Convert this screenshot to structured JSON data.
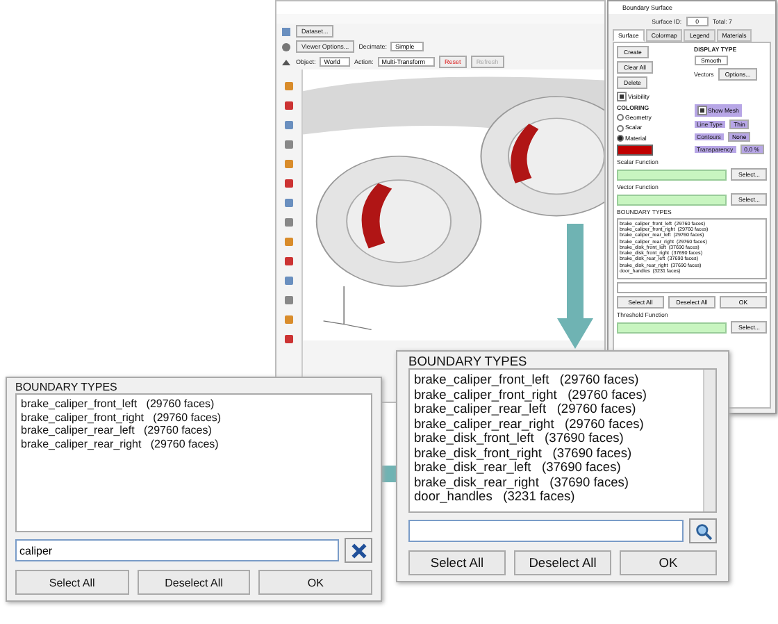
{
  "app_window": {
    "toolbar_rows": [
      [
        {
          "kind": "button",
          "label": "Dataset...",
          "danger": false,
          "disabled": false
        }
      ],
      [
        {
          "kind": "button",
          "label": "Viewer Options...",
          "danger": false,
          "disabled": false
        },
        {
          "kind": "label",
          "label": "Decimate:"
        },
        {
          "kind": "dropdown",
          "label": "Simple"
        }
      ],
      [
        {
          "kind": "label",
          "label": "Object:"
        },
        {
          "kind": "dropdown",
          "label": "World"
        },
        {
          "kind": "label",
          "label": "Action:"
        },
        {
          "kind": "dropdown",
          "label": "Multi-Transform"
        },
        {
          "kind": "button",
          "label": "Reset",
          "danger": true,
          "disabled": false
        },
        {
          "kind": "button",
          "label": "Refresh",
          "danger": false,
          "disabled": true
        }
      ]
    ]
  },
  "surface_panel": {
    "title": "Boundary Surface",
    "surface_id_label": "Surface ID:",
    "surface_id": "0",
    "total": "Total: 7",
    "tabs": [
      {
        "label": "Surface",
        "selected": true
      },
      {
        "label": "Colormap",
        "selected": false
      },
      {
        "label": "Legend",
        "selected": false
      },
      {
        "label": "Materials",
        "selected": false
      }
    ],
    "actions": [
      "Create",
      "Clear All",
      "Delete"
    ],
    "visibility": {
      "label": "Visibility",
      "checked": true
    },
    "display_type": {
      "heading": "DISPLAY TYPE",
      "value": "Smooth",
      "secondary": "Vectors",
      "options_button": "Options..."
    },
    "coloring": {
      "heading": "COLORING",
      "modes": [
        {
          "label": "Geometry",
          "selected": false
        },
        {
          "label": "Scalar",
          "selected": false
        },
        {
          "label": "Material",
          "selected": true
        }
      ]
    },
    "show_mesh": {
      "label": "Show Mesh",
      "checked": true
    },
    "settings": [
      {
        "label": "Line Type",
        "value": "Thin"
      },
      {
        "label": "Contours",
        "value": "None"
      },
      {
        "label": "Transparency",
        "value": "0.0 %"
      }
    ],
    "scalar_function": {
      "heading": "Scalar Function",
      "button": "Select..."
    },
    "vector_function": {
      "heading": "Vector Function",
      "button": "Select..."
    },
    "boundary_list": {
      "heading": "BOUNDARY TYPES",
      "items": [
        "brake_caliper_front_left  (29760 faces)",
        "brake_caliper_front_right  (29760 faces)",
        "brake_caliper_rear_left  (29760 faces)",
        "brake_caliper_rear_right  (29760 faces)",
        "brake_disk_front_left  (37690 faces)",
        "brake_disk_front_right  (37690 faces)",
        "brake_disk_rear_left  (37690 faces)",
        "brake_disk_rear_right  (37690 faces)",
        "door_handles  (3231 faces)"
      ],
      "buttons": [
        "Select All",
        "Deselect All",
        "OK"
      ]
    },
    "threshold_function": {
      "heading": "Threshold Function",
      "button": "Select..."
    }
  },
  "dialogs": [
    {
      "heading": "BOUNDARY TYPES",
      "items": [
        "brake_caliper_front_left   (29760 faces)",
        "brake_caliper_front_right   (29760 faces)",
        "brake_caliper_rear_left   (29760 faces)",
        "brake_caliper_rear_right   (29760 faces)",
        "brake_disk_front_left   (37690 faces)",
        "brake_disk_front_right   (37690 faces)",
        "brake_disk_rear_left   (37690 faces)",
        "brake_disk_rear_right   (37690 faces)",
        "door_handles   (3231 faces)"
      ],
      "search": {
        "kind": "search"
      },
      "buttons": [
        "Select All",
        "Deselect All",
        "OK"
      ]
    },
    {
      "heading": "BOUNDARY TYPES",
      "items": [
        "brake_caliper_front_left   (29760 faces)",
        "brake_caliper_front_right   (29760 faces)",
        "brake_caliper_rear_left   (29760 faces)",
        "brake_caliper_rear_right   (29760 faces)"
      ],
      "search": {
        "kind": "clear",
        "value": "caliper"
      },
      "buttons": [
        "Select All",
        "Deselect All",
        "OK"
      ]
    }
  ]
}
